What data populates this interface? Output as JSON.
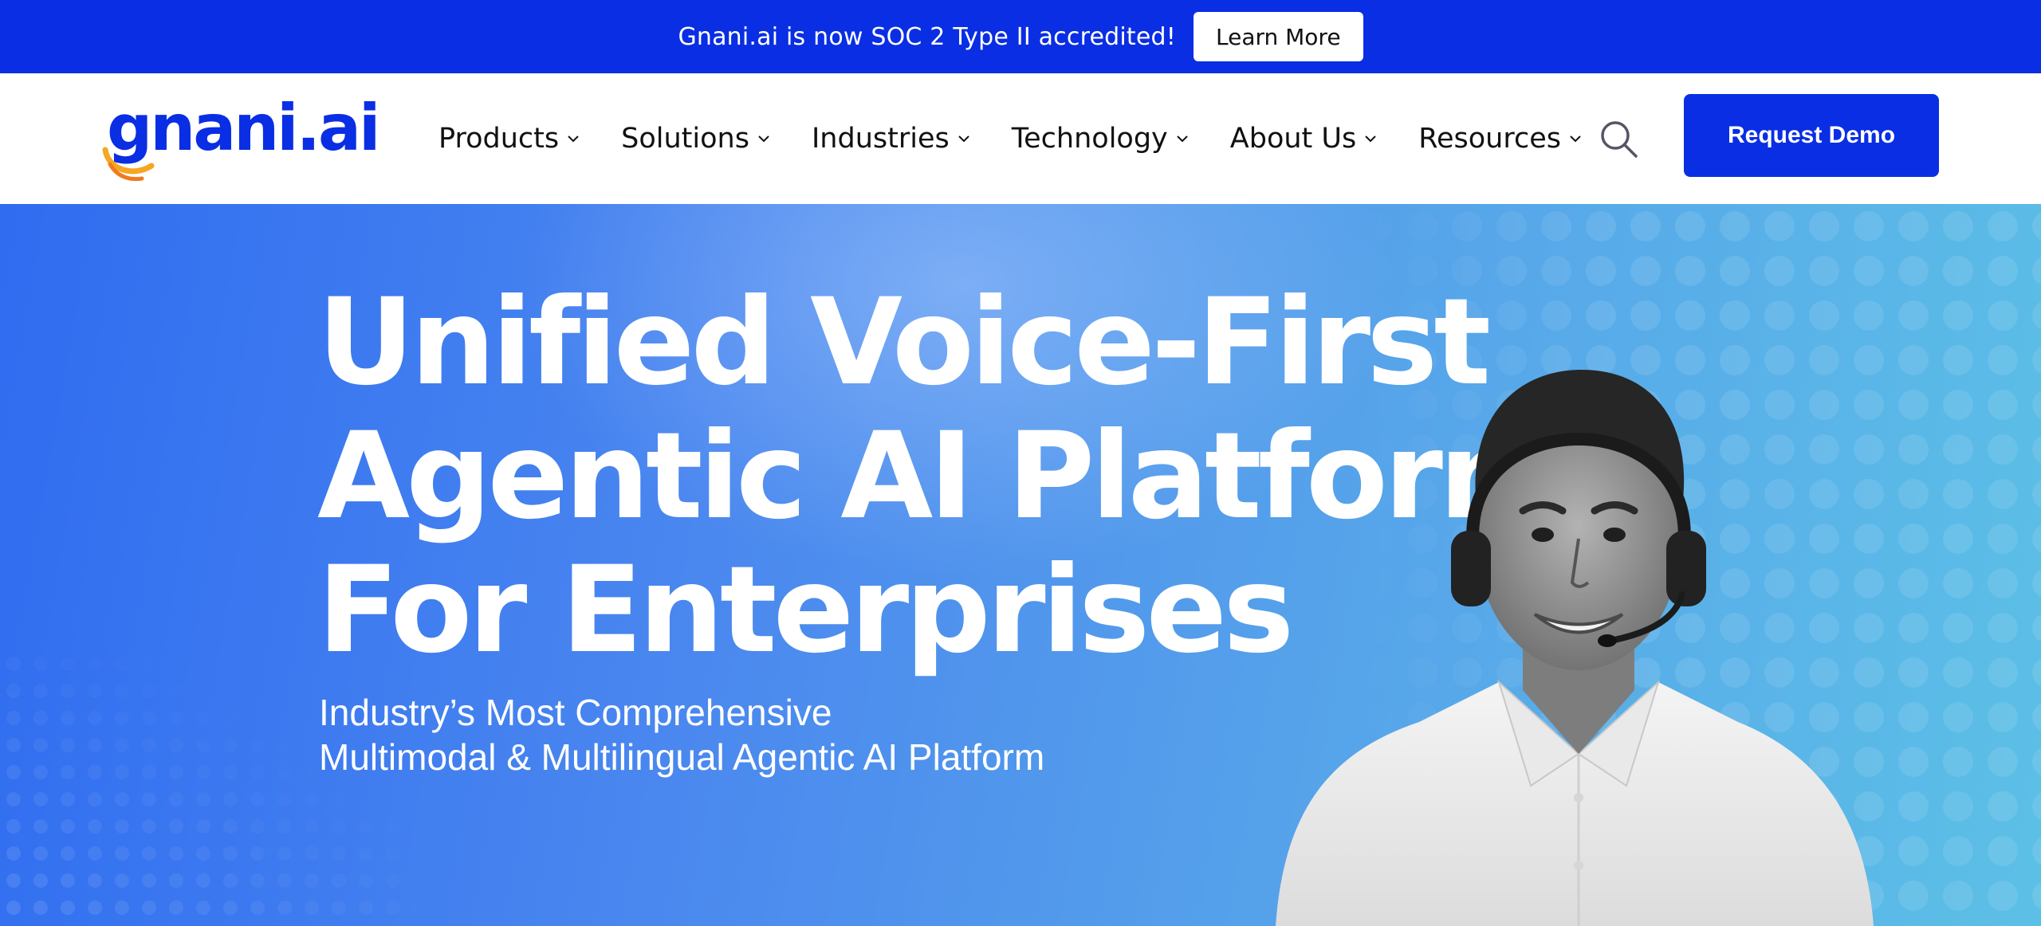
{
  "announcement": {
    "text": "Gnani.ai is now SOC 2 Type II accredited!",
    "button_label": "Learn More"
  },
  "header": {
    "logo_text": "gnani.ai",
    "nav": [
      {
        "label": "Products"
      },
      {
        "label": "Solutions"
      },
      {
        "label": "Industries"
      },
      {
        "label": "Technology"
      },
      {
        "label": "About Us"
      },
      {
        "label": "Resources"
      }
    ],
    "cta_label": "Request Demo"
  },
  "hero": {
    "title_lines": [
      "Unified Voice-First",
      "Agentic AI Platform",
      "For Enterprises"
    ],
    "subtitle_lines": [
      "Industry’s Most Comprehensive",
      "Multimodal & Multilingual Agentic AI Platform"
    ]
  },
  "colors": {
    "brand_blue": "#0a2ee4",
    "hero_gradient_start": "#2f6cf0",
    "hero_gradient_end": "#5cc0e6",
    "logo_accent": "#f5a623"
  },
  "icons": {
    "search": "search-icon",
    "chevron": "chevron-down-icon"
  }
}
